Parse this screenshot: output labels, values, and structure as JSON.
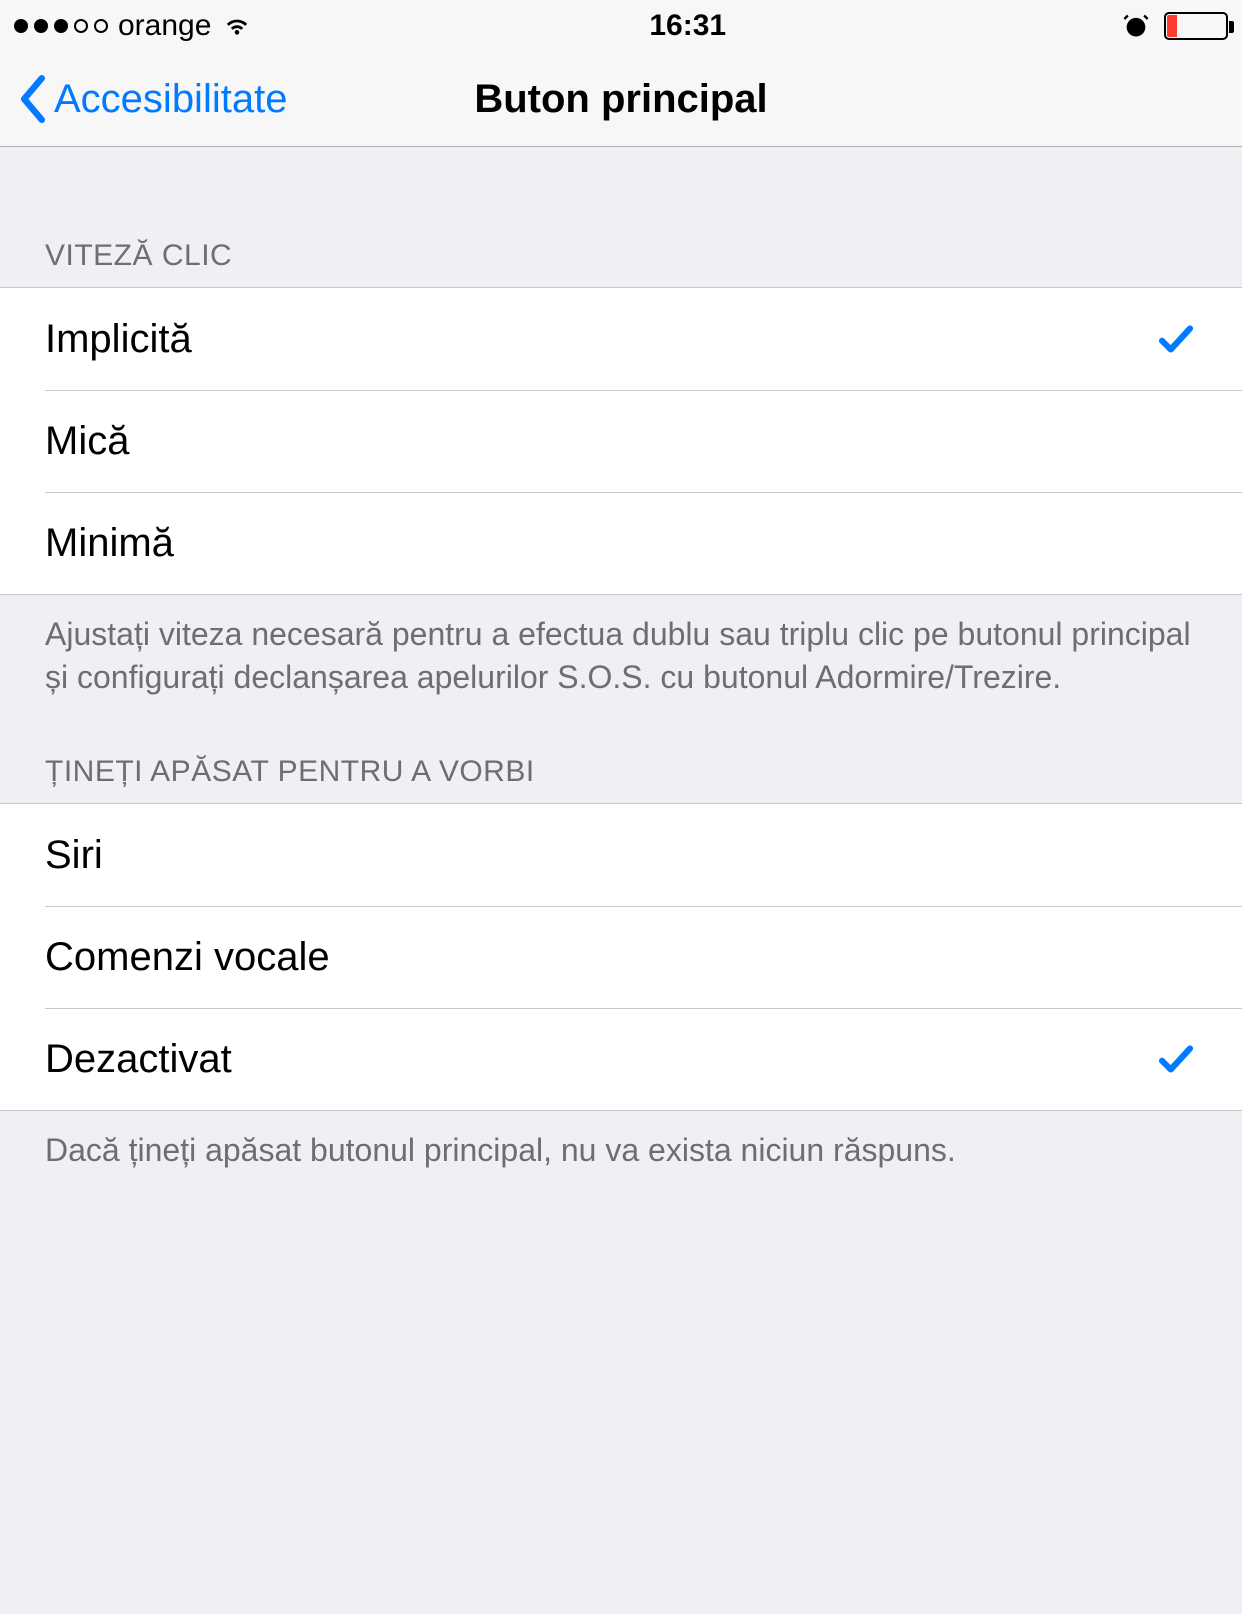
{
  "status_bar": {
    "carrier": "orange",
    "time": "16:31"
  },
  "nav": {
    "back_label": "Accesibilitate",
    "title": "Buton principal"
  },
  "section_click": {
    "header": "VITEZĂ CLIC",
    "options": [
      {
        "label": "Implicită",
        "selected": true
      },
      {
        "label": "Mică",
        "selected": false
      },
      {
        "label": "Minimă",
        "selected": false
      }
    ],
    "footer": "Ajustați viteza necesară pentru a efectua dublu sau triplu clic pe butonul principal și configurați declanșarea apelurilor S.O.S. cu butonul Adormire/Trezire."
  },
  "section_hold": {
    "header": "ȚINEȚI APĂSAT PENTRU A VORBI",
    "options": [
      {
        "label": "Siri",
        "selected": false
      },
      {
        "label": "Comenzi vocale",
        "selected": false
      },
      {
        "label": "Dezactivat",
        "selected": true
      }
    ],
    "footer": "Dacă țineți apăsat butonul principal, nu va exista niciun răspuns."
  }
}
